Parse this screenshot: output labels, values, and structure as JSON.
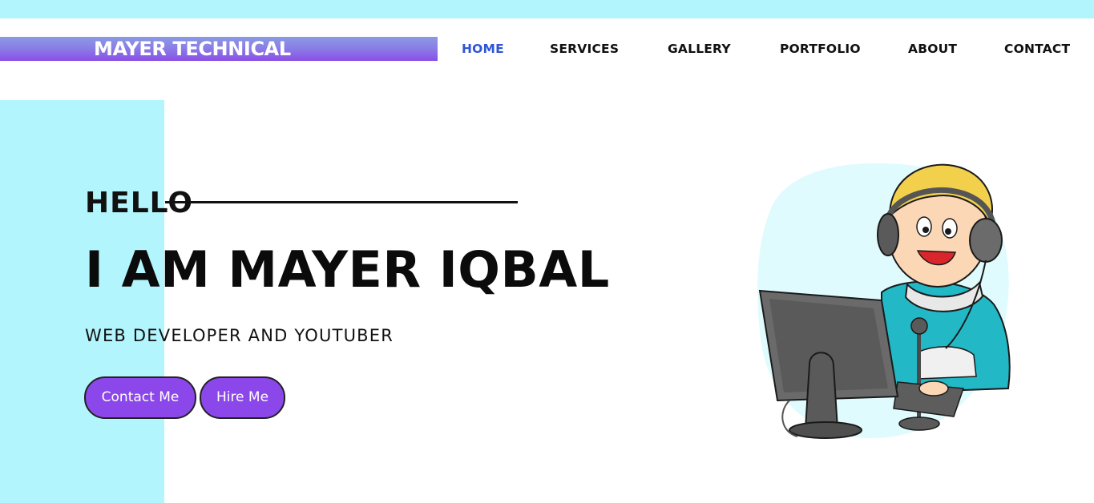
{
  "brand": {
    "name": "MAYER TECHNICAL"
  },
  "nav": {
    "items": [
      {
        "label": "HOME",
        "active": true
      },
      {
        "label": "SERVICES",
        "active": false
      },
      {
        "label": "GALLERY",
        "active": false
      },
      {
        "label": "PORTFOLIO",
        "active": false
      },
      {
        "label": "ABOUT",
        "active": false
      },
      {
        "label": "CONTACT",
        "active": false
      }
    ]
  },
  "hero": {
    "greeting": "HELLO",
    "headline": "I AM MAYER IQBAL",
    "subtitle": "WEB DEVELOPER AND YOUTUBER",
    "buttons": {
      "contact": "Contact Me",
      "hire": "Hire Me"
    },
    "illustration": "boy-with-headset-at-computer"
  },
  "colors": {
    "accent_cyan": "#b3f5fd",
    "brand_purple": "#8b47e9",
    "nav_active": "#2f56d6",
    "text": "#111111"
  }
}
